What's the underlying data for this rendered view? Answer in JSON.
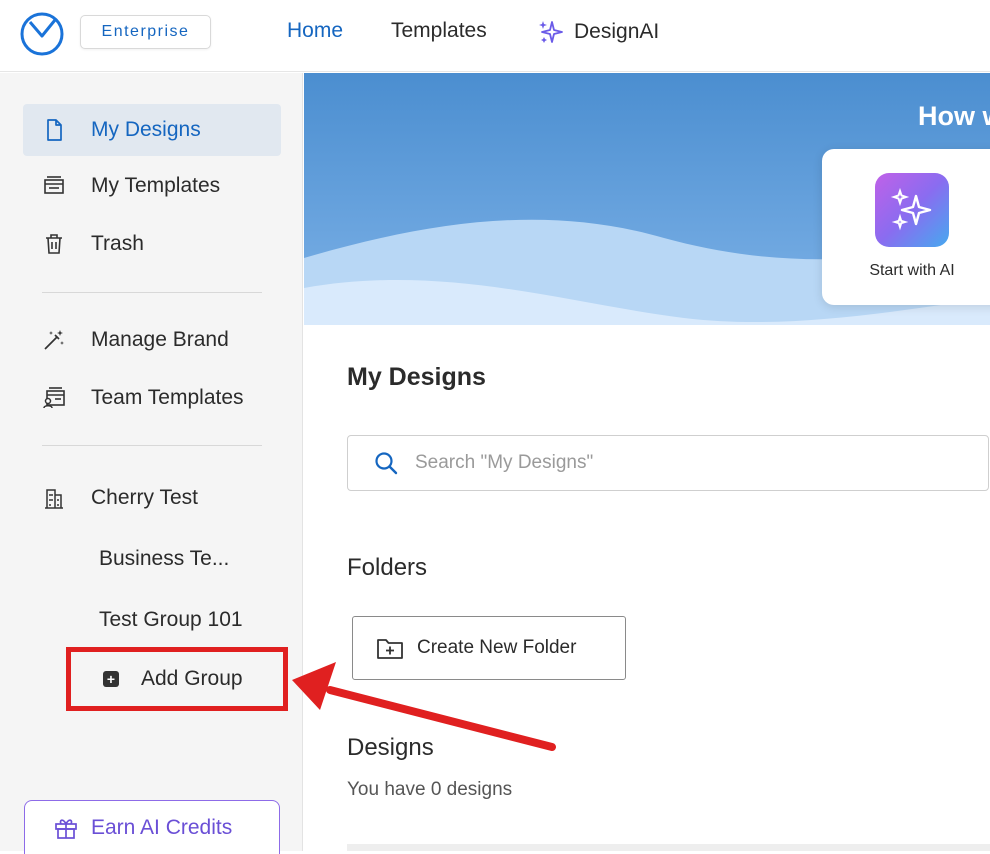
{
  "topbar": {
    "badge": "Enterprise",
    "nav": {
      "home": "Home",
      "templates": "Templates",
      "design_ai": "DesignAI"
    }
  },
  "sidebar": {
    "items": [
      {
        "label": "My Designs",
        "icon": "document-icon",
        "active": true
      },
      {
        "label": "My Templates",
        "icon": "templates-icon"
      },
      {
        "label": "Trash",
        "icon": "trash-icon"
      },
      {
        "label": "Manage Brand",
        "icon": "magic-wand-icon"
      },
      {
        "label": "Team Templates",
        "icon": "team-templates-icon"
      },
      {
        "label": "Cherry Test",
        "icon": "building-icon"
      }
    ],
    "groups": [
      "Business Te...",
      "Test Group 101"
    ],
    "add_group": "Add Group",
    "earn_credits": "Earn AI Credits"
  },
  "hero": {
    "title": "How w",
    "card_label": "Start with AI"
  },
  "main": {
    "title": "My Designs",
    "search_placeholder": "Search \"My Designs\"",
    "folders_heading": "Folders",
    "create_folder": "Create New Folder",
    "designs_heading": "Designs",
    "designs_count": "You have 0 designs"
  },
  "colors": {
    "accent": "#1566c0",
    "highlight_box": "#e02020",
    "active_bg": "#e1e8f0",
    "ai_purple": "#6a4fd6"
  }
}
